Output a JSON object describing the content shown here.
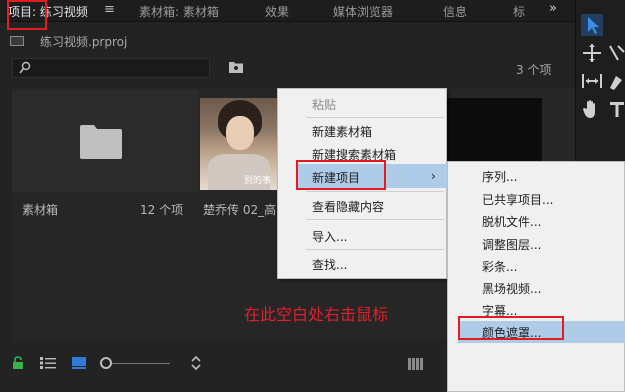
{
  "tabs": [
    {
      "label": "项目: 练习视频",
      "active": true
    },
    {
      "label": "素材箱: 素材箱",
      "active": false
    },
    {
      "label": "效果",
      "active": false
    },
    {
      "label": "媒体浏览器",
      "active": false
    },
    {
      "label": "信息",
      "active": false
    },
    {
      "label": "标",
      "active": false
    }
  ],
  "tab_menu_icon": "≡",
  "overflow_icon": "»",
  "project": {
    "file_name": "练习视频.prproj",
    "item_count": "3 个项"
  },
  "search": {
    "placeholder": ""
  },
  "items": [
    {
      "name": "素材箱",
      "count": "12 个项",
      "type": "bin"
    },
    {
      "name": "楚乔传 02_高",
      "type": "clip",
      "thumb_text": "别的事"
    }
  ],
  "context_menu": {
    "items": [
      {
        "label": "粘贴",
        "disabled": true
      },
      {
        "label": "新建素材箱"
      },
      {
        "label": "新建搜索素材箱"
      },
      {
        "label": "新建项目",
        "highlighted": true,
        "submenu_arrow": "›"
      },
      {
        "label": "查看隐藏内容"
      },
      {
        "label": "导入..."
      },
      {
        "label": "查找..."
      }
    ]
  },
  "submenu": {
    "items": [
      {
        "label": "序列..."
      },
      {
        "label": "已共享项目..."
      },
      {
        "label": "脱机文件..."
      },
      {
        "label": "调整图层..."
      },
      {
        "label": "彩条..."
      },
      {
        "label": "黑场视频..."
      },
      {
        "label": "字幕..."
      },
      {
        "label": "颜色遮罩...",
        "highlighted": true
      }
    ]
  },
  "caption": "在此空白处右击鼠标",
  "colors": {
    "annotation_red": "#e31b23",
    "menu_highlight": "#aecbe8",
    "menu_bg": "#f0f0f0",
    "panel_bg": "#232323",
    "accent_blue": "#2f7cd6"
  },
  "tools": [
    "selection-tool",
    "track-select-tool",
    "ripple-edit-tool",
    "razor-tool",
    "slip-tool",
    "pen-tool",
    "hand-tool",
    "type-tool"
  ]
}
